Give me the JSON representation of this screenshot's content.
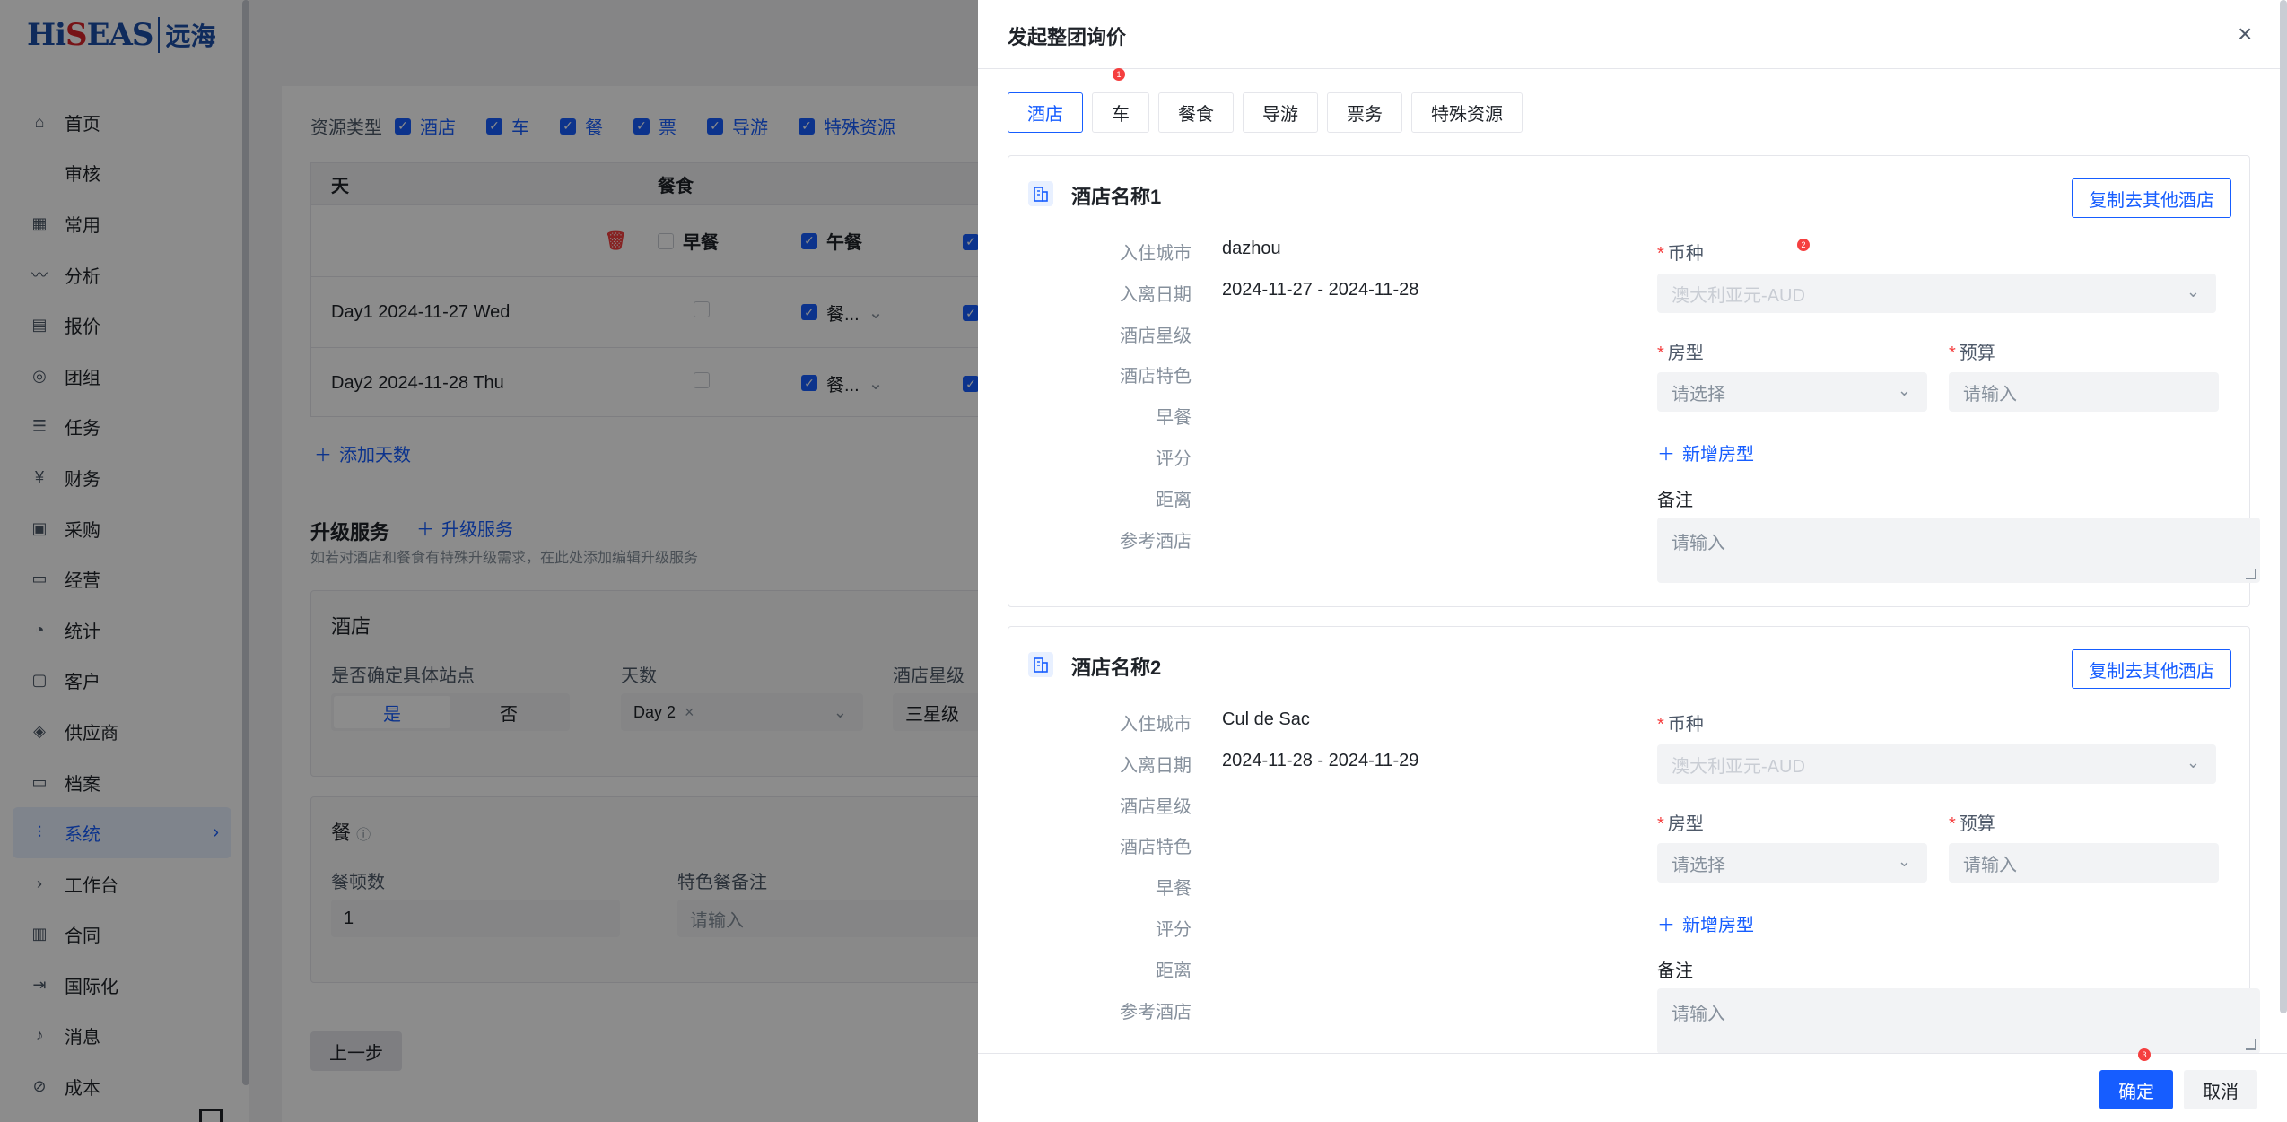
{
  "app": {
    "logo_brand": "HiSEAS",
    "logo_cn": "远海"
  },
  "sidebar": {
    "items": [
      {
        "label": "首页",
        "icon": "home-icon"
      },
      {
        "label": "审核",
        "icon": ""
      },
      {
        "label": "常用",
        "icon": "grid-icon"
      },
      {
        "label": "分析",
        "icon": "chart-icon"
      },
      {
        "label": "报价",
        "icon": "document-icon"
      },
      {
        "label": "团组",
        "icon": "team-icon"
      },
      {
        "label": "任务",
        "icon": "task-icon"
      },
      {
        "label": "财务",
        "icon": "yen-icon"
      },
      {
        "label": "采购",
        "icon": "cart-icon"
      },
      {
        "label": "经营",
        "icon": "monitor-icon"
      },
      {
        "label": "统计",
        "icon": "pie-icon"
      },
      {
        "label": "客户",
        "icon": "customer-icon"
      },
      {
        "label": "供应商",
        "icon": "supplier-icon"
      },
      {
        "label": "档案",
        "icon": "archive-icon"
      },
      {
        "label": "系统",
        "icon": "settings-sliders-icon",
        "active": true
      },
      {
        "label": "工作台",
        "icon": "chevron-right-icon"
      },
      {
        "label": "合同",
        "icon": "contract-icon"
      },
      {
        "label": "国际化",
        "icon": "export-icon"
      },
      {
        "label": "消息",
        "icon": "bell-icon"
      },
      {
        "label": "成本",
        "icon": "cost-icon"
      }
    ]
  },
  "background": {
    "resource_type_label": "资源类型",
    "resource_types": [
      "酒店",
      "车",
      "餐",
      "票",
      "导游",
      "特殊资源"
    ],
    "table": {
      "col_day": "天",
      "col_meal": "餐食",
      "sub_breakfast": "早餐",
      "sub_lunch": "午餐",
      "rows": [
        {
          "day": "Day1 2024-11-27 Wed",
          "lunch": "餐..."
        },
        {
          "day": "Day2 2024-11-28 Thu",
          "lunch": "餐..."
        }
      ]
    },
    "add_days": "添加天数",
    "upgrade_title": "升级服务",
    "upgrade_add": "升级服务",
    "upgrade_desc": "如若对酒店和餐食有特殊升级需求，在此处添加编辑升级服务",
    "hotel_panel": {
      "title": "酒店",
      "site_label": "是否确定具体站点",
      "yes": "是",
      "no": "否",
      "days_label": "天数",
      "days_tag": "Day 2",
      "star_label": "酒店星级",
      "star_value": "三星级"
    },
    "meal_panel": {
      "title": "餐",
      "count_label": "餐顿数",
      "count_value": "1",
      "remark_label": "特色餐备注",
      "remark_placeholder": "请输入"
    },
    "prev_button": "上一步"
  },
  "drawer": {
    "title": "发起整团询价",
    "tabs": [
      "酒店",
      "车",
      "餐食",
      "导游",
      "票务",
      "特殊资源"
    ],
    "hotels": [
      {
        "name": "酒店名称1",
        "copy_label": "复制去其他酒店",
        "city": "dazhou",
        "dates": "2024-11-27 - 2024-11-28",
        "currency": "澳大利亚元-AUD"
      },
      {
        "name": "酒店名称2",
        "copy_label": "复制去其他酒店",
        "city": "Cul de Sac",
        "dates": "2024-11-28 - 2024-11-29",
        "currency": "澳大利亚元-AUD"
      }
    ],
    "labels": {
      "city": "入住城市",
      "dates": "入离日期",
      "star": "酒店星级",
      "feature": "酒店特色",
      "breakfast": "早餐",
      "rating": "评分",
      "distance": "距离",
      "reference": "参考酒店",
      "currency": "币种",
      "room_type": "房型",
      "budget": "预算",
      "add_room": "新增房型",
      "remark": "备注",
      "select_placeholder": "请选择",
      "input_placeholder": "请输入"
    },
    "ok_button": "确定",
    "cancel_button": "取消",
    "badges": [
      "1",
      "2",
      "3"
    ]
  }
}
